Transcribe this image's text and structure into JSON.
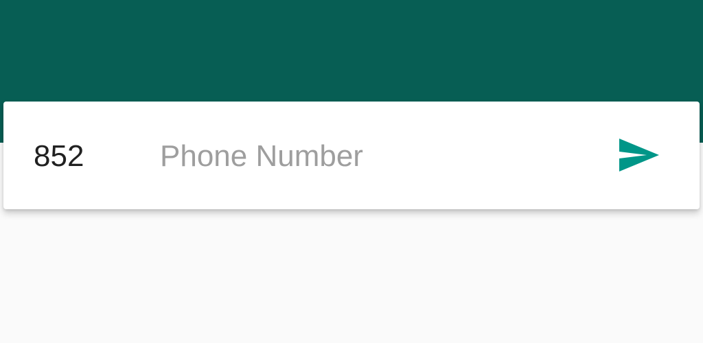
{
  "colors": {
    "app_bar": "#075e54",
    "background": "#fafafa",
    "card": "#ffffff",
    "accent": "#009688",
    "text": "#212121",
    "placeholder": "#9e9e9e"
  },
  "form": {
    "country_code": "852",
    "phone_placeholder": "Phone Number",
    "phone_value": "",
    "send_icon": "send-icon"
  }
}
